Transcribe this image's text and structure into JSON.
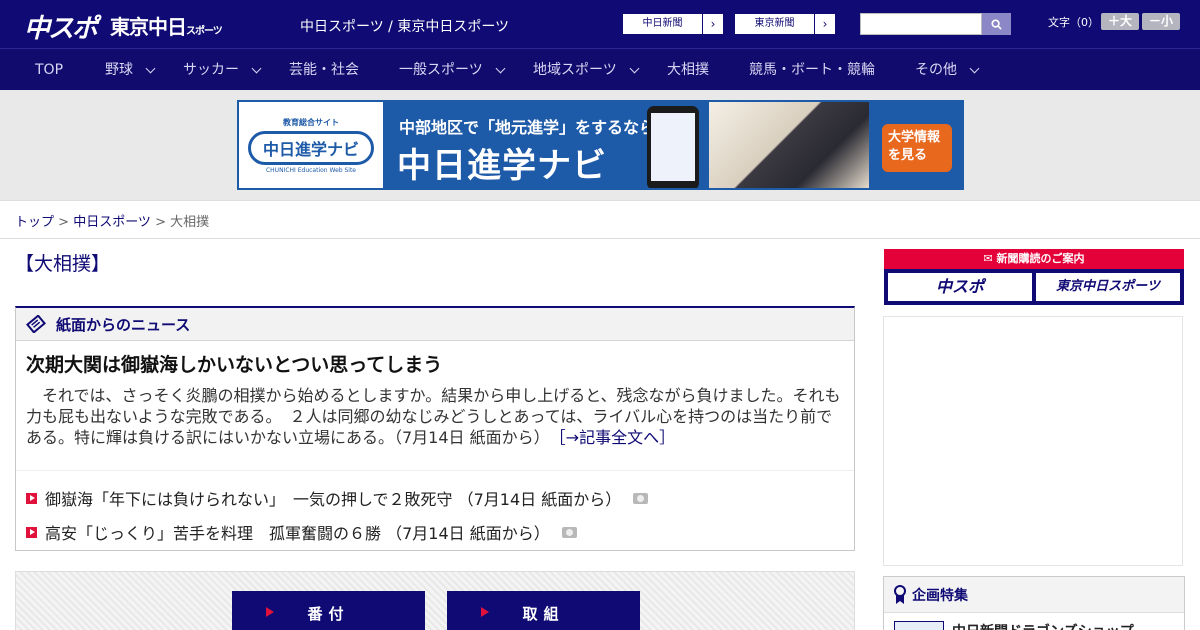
{
  "header": {
    "logo_chuspo": "中スポ",
    "logo_tokyo": "東京中日",
    "logo_tokyo_small": "スポーツ",
    "site_title": "中日スポーツ / 東京中日スポーツ",
    "paper_links": [
      {
        "label": "中日新聞"
      },
      {
        "label": "東京新聞"
      }
    ],
    "search": {
      "value": "",
      "placeholder": ""
    },
    "font_size_label": "文字（0）",
    "font_bigger": "＋大",
    "font_smaller": "－小"
  },
  "nav": {
    "items": [
      {
        "label": "TOP",
        "has_dropdown": false
      },
      {
        "label": "野球",
        "has_dropdown": true
      },
      {
        "label": "サッカー",
        "has_dropdown": true
      },
      {
        "label": "芸能・社会",
        "has_dropdown": false
      },
      {
        "label": "一般スポーツ",
        "has_dropdown": true
      },
      {
        "label": "地域スポーツ",
        "has_dropdown": true
      },
      {
        "label": "大相撲",
        "has_dropdown": false
      },
      {
        "label": "競馬・ボート・競輪",
        "has_dropdown": false
      },
      {
        "label": "その他",
        "has_dropdown": true
      }
    ]
  },
  "banner": {
    "logo_sub": "教育総合サイト",
    "logo_mark": "中日進学ナビ",
    "logo_en": "CHUNICHI Education Web Site",
    "line1": "中部地区で「地元進学」をするなら",
    "line2": "中日進学ナビ",
    "cta": "大学情報を見る"
  },
  "breadcrumb": {
    "home": "トップ",
    "sep": " > ",
    "section": "中日スポーツ",
    "current": "大相撲"
  },
  "page": {
    "heading": "【大相撲】"
  },
  "news_box": {
    "title": "紙面からのニュース",
    "headline": "次期大関は御嶽海しかいないとつい思ってしまう",
    "body": "　それでは、さっそく炎鵬の相撲から始めるとしますか。結果から申し上げると、残念ながら負けました。それも力も屁も出ないような完敗である。　２人は同郷の幼なじみどうしとあっては、ライバル心を持つのは当たり前である。特に輝は負ける訳にはいかない立場にある。（7月14日 紙面から）",
    "more": "［→記事全文へ］",
    "links": [
      {
        "text": "御嶽海「年下には負けられない」　一気の押しで２敗死守 （7月14日 紙面から）"
      },
      {
        "text": "高安「じっくり」苦手を料理　孤軍奮闘の６勝 （7月14日 紙面から）"
      }
    ]
  },
  "tabs": [
    {
      "label": "番付"
    },
    {
      "label": "取組"
    }
  ],
  "sidebar": {
    "subscription_title": "新聞購読のご案内",
    "subscription_buttons": [
      {
        "label": "中スポ"
      },
      {
        "label": "東京中日スポーツ"
      }
    ],
    "special_title": "企画特集",
    "special_item": "中日新聞ドラゴンズショップ"
  },
  "colors": {
    "brand_navy": "#0f0a74",
    "accent_red": "#e0123c",
    "banner_blue": "#1d5aa8"
  }
}
